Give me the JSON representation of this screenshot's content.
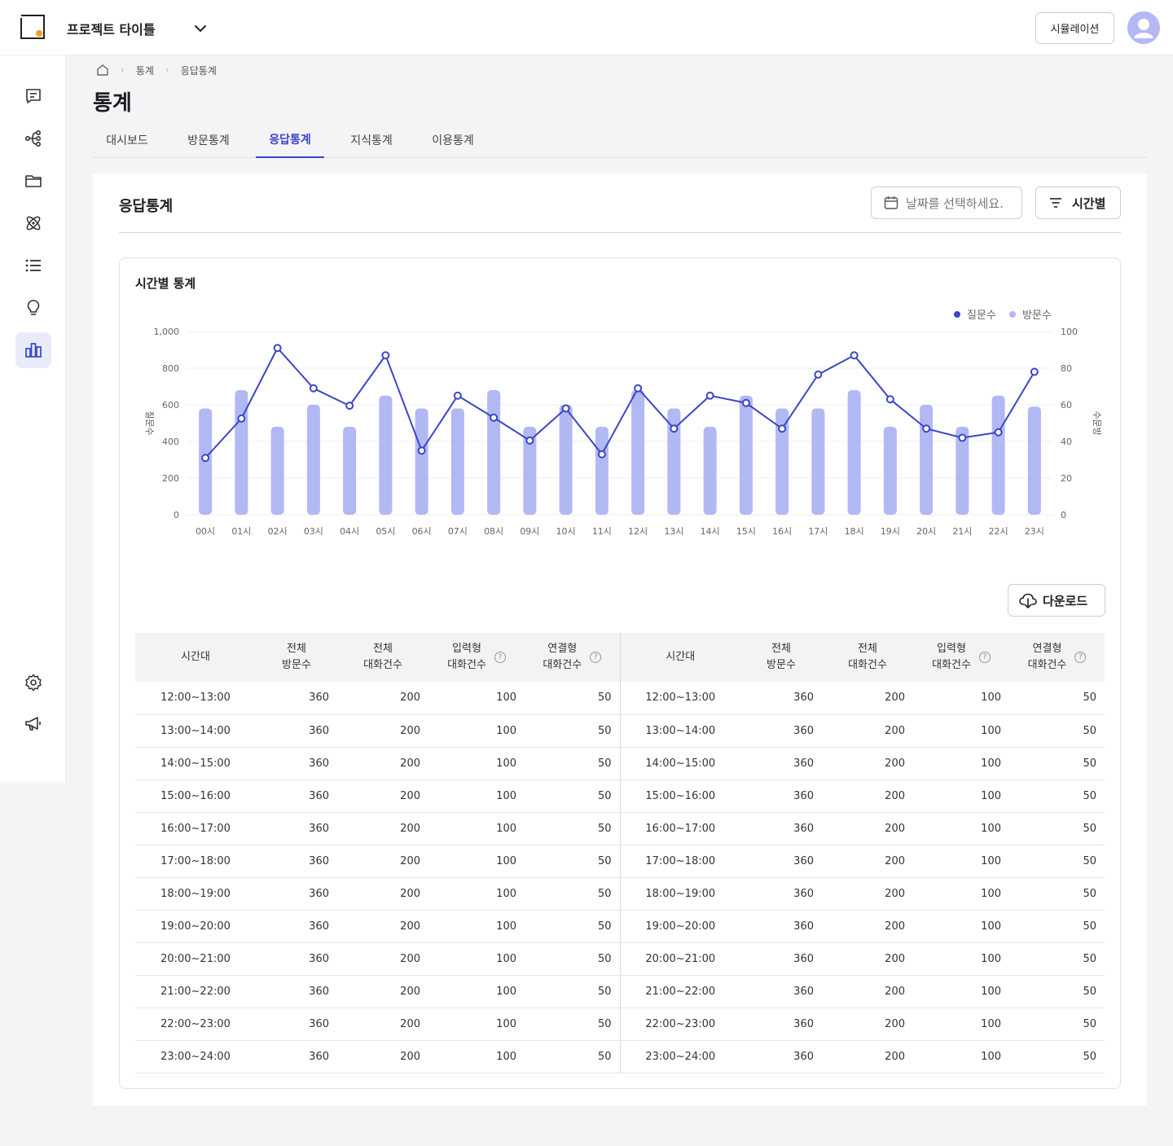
{
  "header": {
    "project_title": "프로젝트 타이틀",
    "simulation_label": "시뮬레이션"
  },
  "breadcrumb": {
    "level1": "통계",
    "level2": "응답통계"
  },
  "page": {
    "title": "통계"
  },
  "tabs": [
    {
      "label": "대시보드",
      "active": false
    },
    {
      "label": "방문통계",
      "active": false
    },
    {
      "label": "응답통계",
      "active": true
    },
    {
      "label": "지식통계",
      "active": false
    },
    {
      "label": "이용통계",
      "active": false
    }
  ],
  "card": {
    "title": "응답통계",
    "date_placeholder": "날짜를 선택하세요.",
    "filter_label": "시간별"
  },
  "chart": {
    "title": "시간별 통계",
    "download_label": "다운로드"
  },
  "chart_data": {
    "type": "bar+line",
    "categories": [
      "00시",
      "01시",
      "02시",
      "03시",
      "04시",
      "05시",
      "06시",
      "07시",
      "08시",
      "09시",
      "10시",
      "11시",
      "12시",
      "13시",
      "14시",
      "15시",
      "16시",
      "17시",
      "18시",
      "19시",
      "20시",
      "21시",
      "22시",
      "23시"
    ],
    "series": [
      {
        "name": "방문수",
        "type": "bar",
        "axis": "right",
        "values": [
          58,
          68,
          48,
          60,
          48,
          65,
          58,
          58,
          68,
          48,
          60,
          48,
          68,
          58,
          48,
          65,
          58,
          58,
          68,
          48,
          60,
          48,
          65,
          59
        ]
      },
      {
        "name": "질문수",
        "type": "line",
        "axis": "left",
        "values": [
          310,
          525,
          910,
          690,
          595,
          870,
          350,
          650,
          530,
          405,
          580,
          330,
          690,
          470,
          650,
          610,
          470,
          765,
          870,
          630,
          470,
          420,
          450,
          780
        ]
      }
    ],
    "ylabel_left": "질문수",
    "ylabel_right": "수문방",
    "ylim_left": [
      0,
      1000
    ],
    "ylim_right": [
      0,
      100
    ],
    "yticks_left": [
      "0",
      "200",
      "400",
      "600",
      "800",
      "1,000"
    ],
    "yticks_right": [
      "0",
      "20",
      "40",
      "60",
      "80",
      "100"
    ],
    "legend": [
      "질문수",
      "방문수"
    ],
    "legend_position": "top-right",
    "colors": {
      "line": "#3b45c6",
      "bar": "#b1b8f4"
    }
  },
  "table": {
    "headers": {
      "time": "시간대",
      "visits_1": "전체",
      "visits_2": "방문수",
      "conv_1": "전체",
      "conv_2": "대화건수",
      "input_1": "입력형",
      "input_2": "대화건수",
      "link_1": "연결형",
      "link_2": "대화건수",
      "help": "?"
    },
    "rows": [
      {
        "time": "12:00~13:00",
        "visits": "360",
        "conv": "200",
        "input": "100",
        "link": "50"
      },
      {
        "time": "13:00~14:00",
        "visits": "360",
        "conv": "200",
        "input": "100",
        "link": "50"
      },
      {
        "time": "14:00~15:00",
        "visits": "360",
        "conv": "200",
        "input": "100",
        "link": "50"
      },
      {
        "time": "15:00~16:00",
        "visits": "360",
        "conv": "200",
        "input": "100",
        "link": "50"
      },
      {
        "time": "16:00~17:00",
        "visits": "360",
        "conv": "200",
        "input": "100",
        "link": "50"
      },
      {
        "time": "17:00~18:00",
        "visits": "360",
        "conv": "200",
        "input": "100",
        "link": "50"
      },
      {
        "time": "18:00~19:00",
        "visits": "360",
        "conv": "200",
        "input": "100",
        "link": "50"
      },
      {
        "time": "19:00~20:00",
        "visits": "360",
        "conv": "200",
        "input": "100",
        "link": "50"
      },
      {
        "time": "20:00~21:00",
        "visits": "360",
        "conv": "200",
        "input": "100",
        "link": "50"
      },
      {
        "time": "21:00~22:00",
        "visits": "360",
        "conv": "200",
        "input": "100",
        "link": "50"
      },
      {
        "time": "22:00~23:00",
        "visits": "360",
        "conv": "200",
        "input": "100",
        "link": "50"
      },
      {
        "time": "23:00~24:00",
        "visits": "360",
        "conv": "200",
        "input": "100",
        "link": "50"
      }
    ]
  },
  "colors": {
    "accent": "#3b45c6",
    "bar": "#b1b8f4",
    "avatar_bg": "#b4b8f4",
    "logo_dot": "#f0a020"
  },
  "sidebar": {
    "icons": [
      "chat-icon",
      "flow-icon",
      "folder-icon",
      "atom-icon",
      "list-icon",
      "bulb-icon",
      "chart-icon",
      "settings-icon",
      "megaphone-icon"
    ],
    "active": "chart-icon"
  }
}
